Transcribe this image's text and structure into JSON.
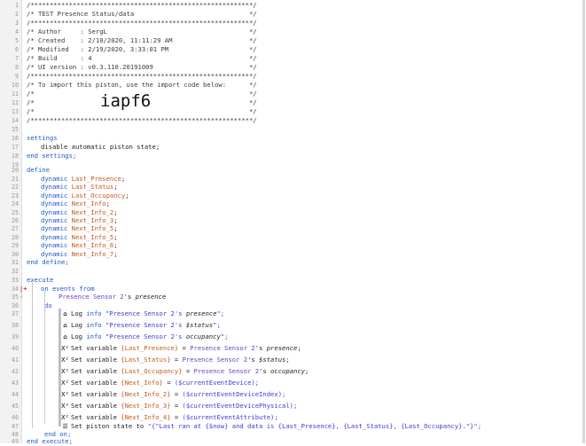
{
  "import_code": "iapf6",
  "header": [
    "/**********************************************************/",
    "/* TEST Presence Status/data                              */",
    "/**********************************************************/",
    "/* Author     : SergL                                     */",
    "/* Created    : 2/10/2020, 11:11:29 AM                    */",
    "/* Modified   : 2/19/2020, 3:33:01 PM                     */",
    "/* Build      : 4                                         */",
    "/* UI version : v0.3.110.20191009                         */",
    "/**********************************************************/",
    "/* To import this piston, use the import code below:      */",
    "/*                                                        */",
    "/*                                                        */",
    "/*                                                        */",
    "/**********************************************************/"
  ],
  "settings": {
    "open": "settings",
    "body": "disable automatic piston state;",
    "close": "end settings;"
  },
  "define": {
    "open": "define",
    "dynamic_kw": "dynamic",
    "vars": [
      "Last_Presence",
      "Last_Status",
      "Last_Occupancy",
      "Next_Info",
      "Next_Info_2",
      "Next_Info_3",
      "Next_Info_5",
      "Next_Info_5",
      "Next_Info_6",
      "Next_Info_7"
    ],
    "close": "end define;"
  },
  "execute": {
    "open": "execute",
    "on_events": "on events from",
    "device": "Presence Sensor 2",
    "poss": "'s",
    "presence_attr": "presence",
    "do": "do",
    "end_on": "end on;",
    "close": "end execute;"
  },
  "statements": {
    "log1": {
      "cmd": "Log",
      "level": "info",
      "str_open": "\"Presence Sensor 2's ",
      "attr": "presence",
      "str_close": "\";"
    },
    "log2": {
      "cmd": "Log",
      "level": "info",
      "str_open": "\"Presence Sensor 2's ",
      "attr": "$status",
      "str_close": "\";"
    },
    "log3": {
      "cmd": "Log",
      "level": "info",
      "str_open": "\"Presence Sensor 2's ",
      "attr": "occupancy",
      "str_close": "\";"
    },
    "set1": {
      "cmd": "Set variable",
      "var": "{Last_Presence}",
      "eq": "=",
      "dev": "Presence Sensor 2",
      "poss": "'s",
      "attr": "presence",
      "end": ";"
    },
    "set2": {
      "cmd": "Set variable",
      "var": "{Last_Status}",
      "eq": "=",
      "dev": "Presence Sensor 2",
      "poss": "'s",
      "attr": "$status",
      "end": ";"
    },
    "set3": {
      "cmd": "Set variable",
      "var": "{Last_Occupancy}",
      "eq": "=",
      "dev": "Presence Sensor 2",
      "poss": "'s",
      "attr": "occupancy",
      "end": ";"
    },
    "set4": {
      "cmd": "Set variable",
      "var": "{Next_Info}",
      "eq": "=",
      "val": "($currentEventDevice);"
    },
    "set5": {
      "cmd": "Set variable",
      "var": "{Next_Info_2}",
      "eq": "=",
      "val": "($currentEventDeviceIndex);"
    },
    "set6": {
      "cmd": "Set variable",
      "var": "{Next_Info_3}",
      "eq": "=",
      "val": "($currentEventDevicePhysical);"
    },
    "set7": {
      "cmd": "Set variable",
      "var": "{Next_Info_4}",
      "eq": "=",
      "val": "($currentEventAttribute);"
    },
    "state": {
      "cmd": "Set piston state to",
      "val": "\"{\"Last ran at {$now} and data is {Last_Presence}, {Last_Status}, {Last_Occupancy}.\"}\";"
    }
  },
  "icons": {
    "log": "house-icon",
    "set": "x-squared-icon",
    "state": "list-icon",
    "trigger": "lightning-icon"
  }
}
